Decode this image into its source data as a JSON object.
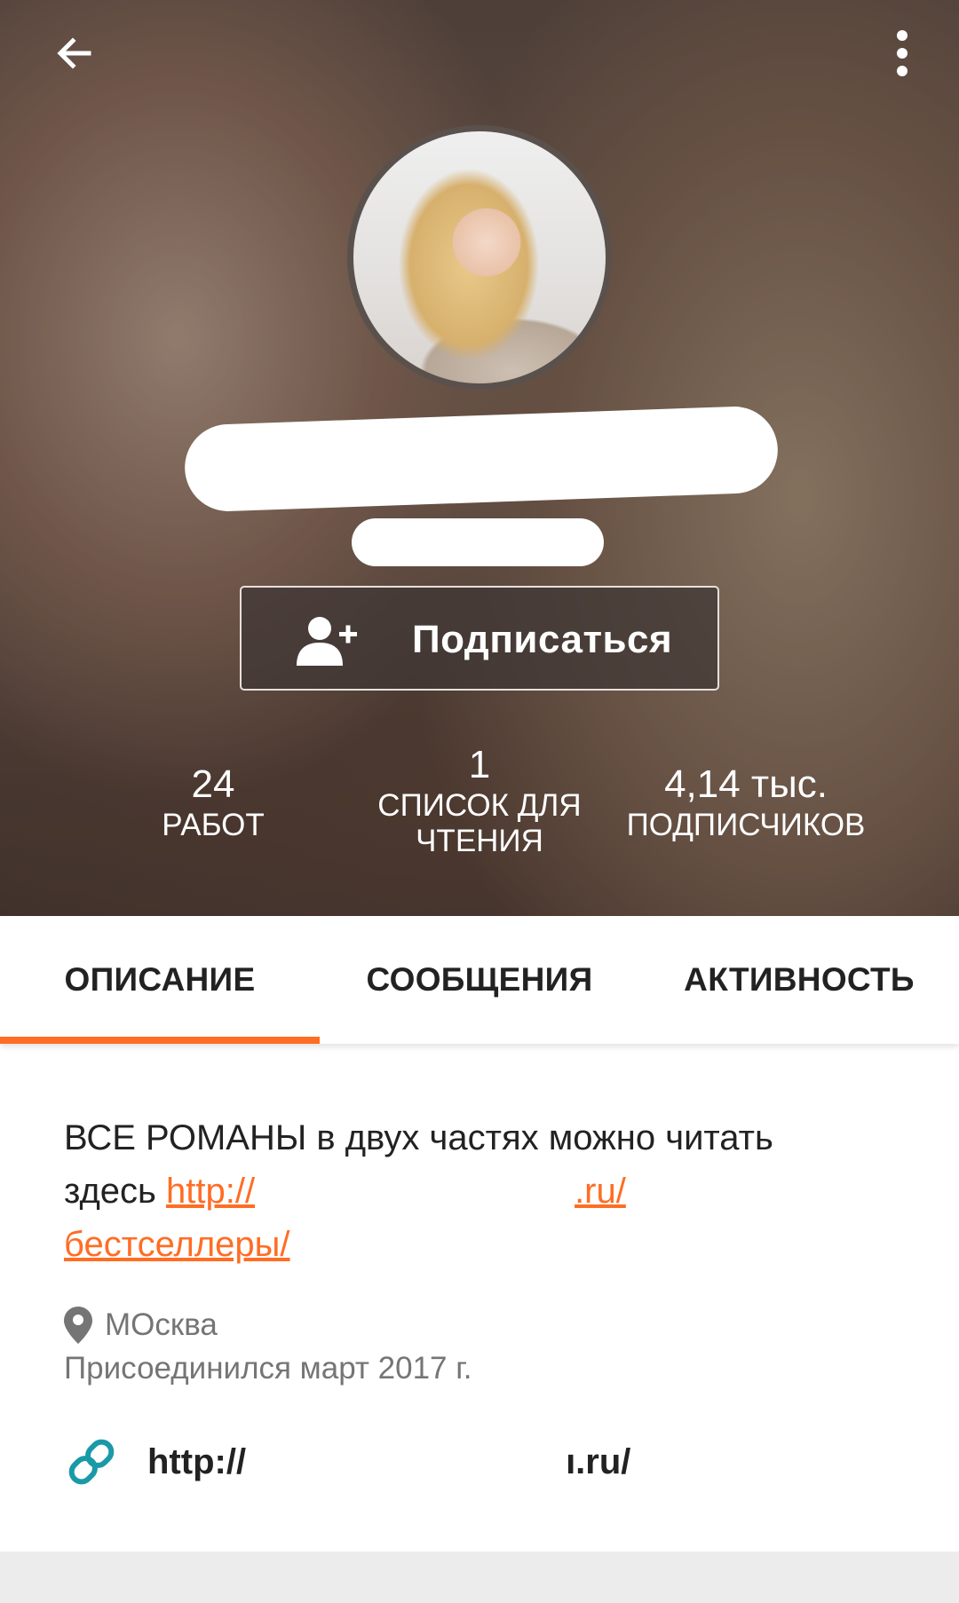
{
  "header": {
    "back_icon": "arrow-left-icon",
    "more_icon": "more-vertical-icon",
    "follow_button": {
      "label": "Подписаться",
      "icon": "add-person-icon"
    },
    "stats": [
      {
        "value": "24",
        "label": "РАБОТ"
      },
      {
        "value": "1",
        "label": "СПИСОК ДЛЯ ЧТЕНИЯ"
      },
      {
        "value": "4,14 тыс.",
        "label": "ПОДПИСЧИКОВ"
      }
    ]
  },
  "tabs": [
    {
      "label": "ОПИСАНИЕ",
      "active": true
    },
    {
      "label": "СООБЩЕНИЯ",
      "active": false
    },
    {
      "label": "АКТИВНОСТЬ",
      "active": false
    }
  ],
  "about": {
    "description_prefix": "ВСЕ РОМАНЫ в двух частях можно читать здесь ",
    "link_part1": "http://",
    "link_part2": ".ru/",
    "link_part3": "бестселлеры/",
    "location": "МОсква",
    "joined": "Присоединился март 2017 г.",
    "website_part1": "http://",
    "website_part2": "ı.ru/"
  },
  "colors": {
    "accent": "#ff6d24",
    "link_icon": "#1a9aa8",
    "text_primary": "#222222",
    "text_secondary": "#757575"
  }
}
